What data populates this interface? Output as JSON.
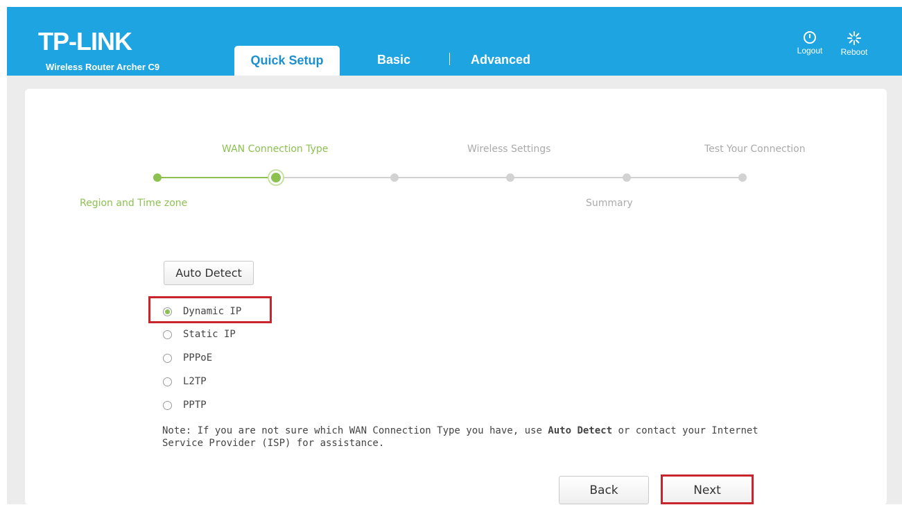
{
  "header": {
    "logo": "TP-LINK",
    "model": "Wireless Router Archer C9",
    "tabs": {
      "quick_setup": "Quick Setup",
      "basic": "Basic",
      "advanced": "Advanced"
    },
    "logout_label": "Logout",
    "reboot_label": "Reboot"
  },
  "wizard": {
    "steps": {
      "region": "Region and Time zone",
      "wan": "WAN Connection Type",
      "wireless": "Wireless Settings",
      "summary": "Summary",
      "test": "Test Your Connection"
    },
    "current_step": 2,
    "total_steps": 6
  },
  "form": {
    "auto_detect_label": "Auto Detect",
    "selected": "Dynamic IP",
    "options": {
      "dynamic": "Dynamic IP",
      "static": "Static IP",
      "pppoe": "PPPoE",
      "l2tp": "L2TP",
      "pptp": "PPTP"
    },
    "note_prefix": "Note: If you are not sure which WAN Connection Type you have, use ",
    "note_bold": "Auto Detect",
    "note_suffix": " or contact your Internet Service Provider (ISP) for assistance."
  },
  "buttons": {
    "back": "Back",
    "next": "Next"
  },
  "colors": {
    "header": "#1ea5e1",
    "progress_done": "#8cc152",
    "progress_pending": "#d2d2d2",
    "highlight": "#c8242b"
  }
}
